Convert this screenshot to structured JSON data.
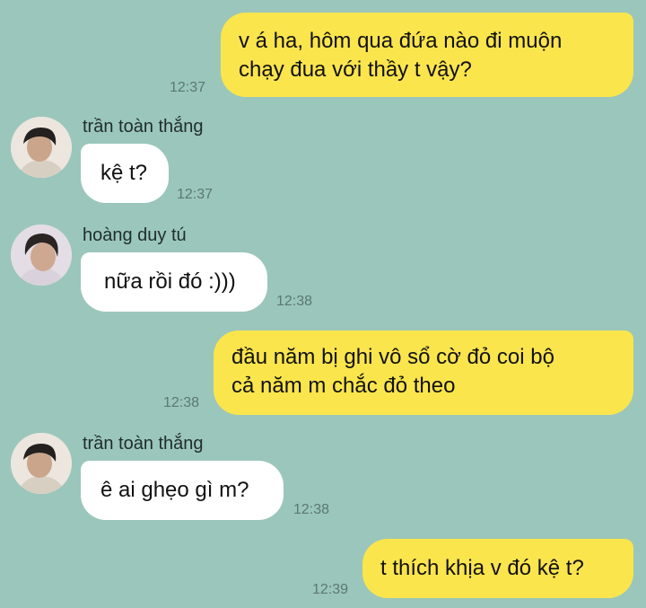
{
  "messages": [
    {
      "from": "me",
      "text_lines": [
        "v á ha, hôm qua đứa nào đi muộn",
        "chạy đua với thầy t vậy?"
      ],
      "time": "12:37"
    },
    {
      "from": "other",
      "sender": "trần toàn thắng",
      "avatar_icon": "person-avatar-icon",
      "text": "kệ t?",
      "time": "12:37"
    },
    {
      "from": "other",
      "sender": "hoàng duy tú",
      "avatar_icon": "person-avatar-icon",
      "text": "nữa rồi đó :)))",
      "time": "12:38"
    },
    {
      "from": "me",
      "text_lines": [
        "đầu năm bị ghi vô sổ cờ đỏ coi bộ",
        "cả năm m chắc đỏ theo"
      ],
      "time": "12:38"
    },
    {
      "from": "other",
      "sender": "trần toàn thắng",
      "avatar_icon": "person-avatar-icon",
      "text": "ê ai ghẹo gì m?",
      "time": "12:38"
    },
    {
      "from": "me",
      "text": "t thích khịa v đó kệ t?",
      "time": "12:39"
    }
  ],
  "colors": {
    "background": "#9bc6bb",
    "my_bubble": "#fbe54d",
    "other_bubble": "#ffffff",
    "timestamp": "#5b7873"
  }
}
